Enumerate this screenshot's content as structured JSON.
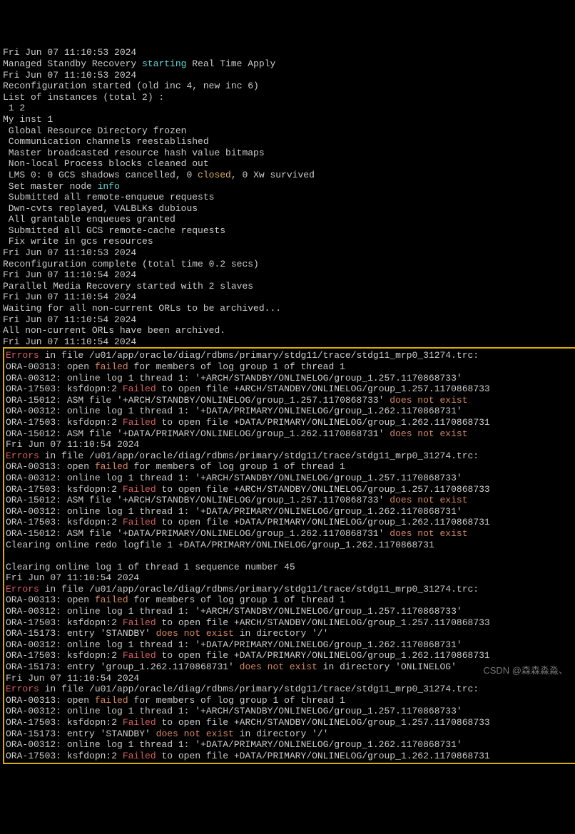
{
  "top": {
    "l0": "Fri Jun 07 11:10:53 2024",
    "l1a": "Managed Standby Recovery ",
    "l1b": "starting",
    "l1c": " Real Time Apply",
    "l2": "Fri Jun 07 11:10:53 2024",
    "l3": "Reconfiguration started (old inc 4, new inc 6)",
    "l4": "List of instances (total 2) :",
    "l5": " 1 2",
    "l6": "My inst 1",
    "l7": " Global Resource Directory frozen",
    "l8": " Communication channels reestablished",
    "l9": " Master broadcasted resource hash value bitmaps",
    "l10": " Non-local Process blocks cleaned out",
    "l11a": " LMS 0: 0 GCS shadows cancelled, 0 ",
    "l11b": "closed",
    "l11c": ", 0 Xw survived",
    "l12a": " Set master node ",
    "l12b": "info",
    "l13": " Submitted all remote-enqueue requests",
    "l14": " Dwn-cvts replayed, VALBLKs dubious",
    "l15": " All grantable enqueues granted",
    "l16": " Submitted all GCS remote-cache requests",
    "l17": " Fix write in gcs resources",
    "l18": "Fri Jun 07 11:10:53 2024",
    "l19": "Reconfiguration complete (total time 0.2 secs)",
    "l20": "Fri Jun 07 11:10:54 2024",
    "l21": "Parallel Media Recovery started with 2 slaves",
    "l22": "Fri Jun 07 11:10:54 2024",
    "l23": "Waiting for all non-current ORLs to be archived...",
    "l24": "Fri Jun 07 11:10:54 2024",
    "l25": "All non-current ORLs have been archived.",
    "l26": "Fri Jun 07 11:10:54 2024"
  },
  "box": {
    "e1a": "Errors",
    "e1b": " in file /u01/app/oracle/diag/rdbms/primary/stdg11/trace/stdg11_mrp0_31274.trc:",
    "e2a": "ORA-00313: open ",
    "e2b": "failed",
    "e2c": " for members of log group 1 of thread 1",
    "e3": "ORA-00312: online log 1 thread 1: '+ARCH/STANDBY/ONLINELOG/group_1.257.1170868733'",
    "e4a": "ORA-17503: ksfdopn:2 ",
    "e4b": "Failed",
    "e4c": " to open file +ARCH/STANDBY/ONLINELOG/group_1.257.1170868733",
    "e5a": "ORA-15012: ASM file '+ARCH/STANDBY/ONLINELOG/group_1.257.1170868733' ",
    "e5b": "does not exist",
    "e6": "ORA-00312: online log 1 thread 1: '+DATA/PRIMARY/ONLINELOG/group_1.262.1170868731'",
    "e7a": "ORA-17503: ksfdopn:2 ",
    "e7b": "Failed",
    "e7c": " to open file +DATA/PRIMARY/ONLINELOG/group_1.262.1170868731",
    "e8a": "ORA-15012: ASM file '+DATA/PRIMARY/ONLINELOG/group_1.262.1170868731' ",
    "e8b": "does not exist",
    "e9": "Fri Jun 07 11:10:54 2024",
    "e10a": "Errors",
    "e10b": " in file /u01/app/oracle/diag/rdbms/primary/stdg11/trace/stdg11_mrp0_31274.trc:",
    "e11a": "ORA-00313: open ",
    "e11b": "failed",
    "e11c": " for members of log group 1 of thread 1",
    "e12": "ORA-00312: online log 1 thread 1: '+ARCH/STANDBY/ONLINELOG/group_1.257.1170868733'",
    "e13a": "ORA-17503: ksfdopn:2 ",
    "e13b": "Failed",
    "e13c": " to open file +ARCH/STANDBY/ONLINELOG/group_1.257.1170868733",
    "e14a": "ORA-15012: ASM file '+ARCH/STANDBY/ONLINELOG/group_1.257.1170868733' ",
    "e14b": "does not exist",
    "e15": "ORA-00312: online log 1 thread 1: '+DATA/PRIMARY/ONLINELOG/group_1.262.1170868731'",
    "e16a": "ORA-17503: ksfdopn:2 ",
    "e16b": "Failed",
    "e16c": " to open file +DATA/PRIMARY/ONLINELOG/group_1.262.1170868731",
    "e17a": "ORA-15012: ASM file '+DATA/PRIMARY/ONLINELOG/group_1.262.1170868731' ",
    "e17b": "does not exist",
    "e18": "Clearing online redo logfile 1 +DATA/PRIMARY/ONLINELOG/group_1.262.1170868731",
    "e19": "",
    "e20": "Clearing online log 1 of thread 1 sequence number 45",
    "e21": "Fri Jun 07 11:10:54 2024",
    "e22a": "Errors",
    "e22b": " in file /u01/app/oracle/diag/rdbms/primary/stdg11/trace/stdg11_mrp0_31274.trc:",
    "e23a": "ORA-00313: open ",
    "e23b": "failed",
    "e23c": " for members of log group 1 of thread 1",
    "e24": "ORA-00312: online log 1 thread 1: '+ARCH/STANDBY/ONLINELOG/group_1.257.1170868733'",
    "e25a": "ORA-17503: ksfdopn:2 ",
    "e25b": "Failed",
    "e25c": " to open file +ARCH/STANDBY/ONLINELOG/group_1.257.1170868733",
    "e26a": "ORA-15173: entry 'STANDBY' ",
    "e26b": "does not exist",
    "e26c": " in directory '/'",
    "e27": "ORA-00312: online log 1 thread 1: '+DATA/PRIMARY/ONLINELOG/group_1.262.1170868731'",
    "e28a": "ORA-17503: ksfdopn:2 ",
    "e28b": "Failed",
    "e28c": " to open file +DATA/PRIMARY/ONLINELOG/group_1.262.1170868731",
    "e29a": "ORA-15173: entry 'group_1.262.1170868731' ",
    "e29b": "does not exist",
    "e29c": " in directory 'ONLINELOG'",
    "e30": "Fri Jun 07 11:10:54 2024",
    "e31a": "Errors",
    "e31b": " in file /u01/app/oracle/diag/rdbms/primary/stdg11/trace/stdg11_mrp0_31274.trc:",
    "e32a": "ORA-00313: open ",
    "e32b": "failed",
    "e32c": " for members of log group 1 of thread 1",
    "e33": "ORA-00312: online log 1 thread 1: '+ARCH/STANDBY/ONLINELOG/group_1.257.1170868733'",
    "e34a": "ORA-17503: ksfdopn:2 ",
    "e34b": "Failed",
    "e34c": " to open file +ARCH/STANDBY/ONLINELOG/group_1.257.1170868733",
    "e35a": "ORA-15173: entry 'STANDBY' ",
    "e35b": "does not exist",
    "e35c": " in directory '/'",
    "e36": "ORA-00312: online log 1 thread 1: '+DATA/PRIMARY/ONLINELOG/group_1.262.1170868731'",
    "e37a": "ORA-17503: ksfdopn:2 ",
    "e37b": "Failed",
    "e37c": " to open file +DATA/PRIMARY/ONLINELOG/group_1.262.1170868731"
  },
  "watermark": "CSDN @森森淼淼、"
}
